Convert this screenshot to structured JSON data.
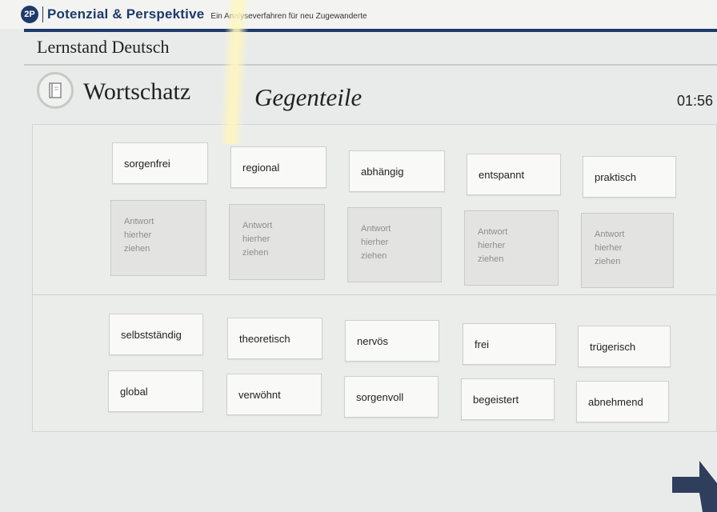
{
  "header": {
    "logo_text": "2P",
    "brand": "Potenzial & Perspektive",
    "subtitle": "Ein Analyseverfahren für neu Zugewanderte"
  },
  "section_title": "Lernstand Deutsch",
  "topic": "Wortschatz",
  "task_title": "Gegenteile",
  "timer": "01:56",
  "top_words": [
    "sorgenfrei",
    "regional",
    "abhängig",
    "entspannt",
    "praktisch"
  ],
  "drop_zones": [
    {
      "line1": "Antwort",
      "line2": "hierher",
      "line3": "ziehen"
    },
    {
      "line1": "Antwort",
      "line2": "hierher",
      "line3": "ziehen"
    },
    {
      "line1": "Antwort",
      "line2": "hierher",
      "line3": "ziehen"
    },
    {
      "line1": "Antwort",
      "line2": "hierher",
      "line3": "ziehen"
    },
    {
      "line1": "Antwort",
      "line2": "hierher",
      "line3": "ziehen"
    }
  ],
  "answer_options": [
    "selbstständig",
    "theoretisch",
    "nervös",
    "frei",
    "trügerisch",
    "global",
    "verwöhnt",
    "sorgenvoll",
    "begeistert",
    "abnehmend"
  ],
  "colors": {
    "brand": "#1f3a6a",
    "background": "#e9ebea",
    "card": "#f9f9f7",
    "drop_zone": "#e3e4e2"
  },
  "icons": {
    "topic_icon": "book-icon",
    "next": "arrow-right-icon"
  }
}
